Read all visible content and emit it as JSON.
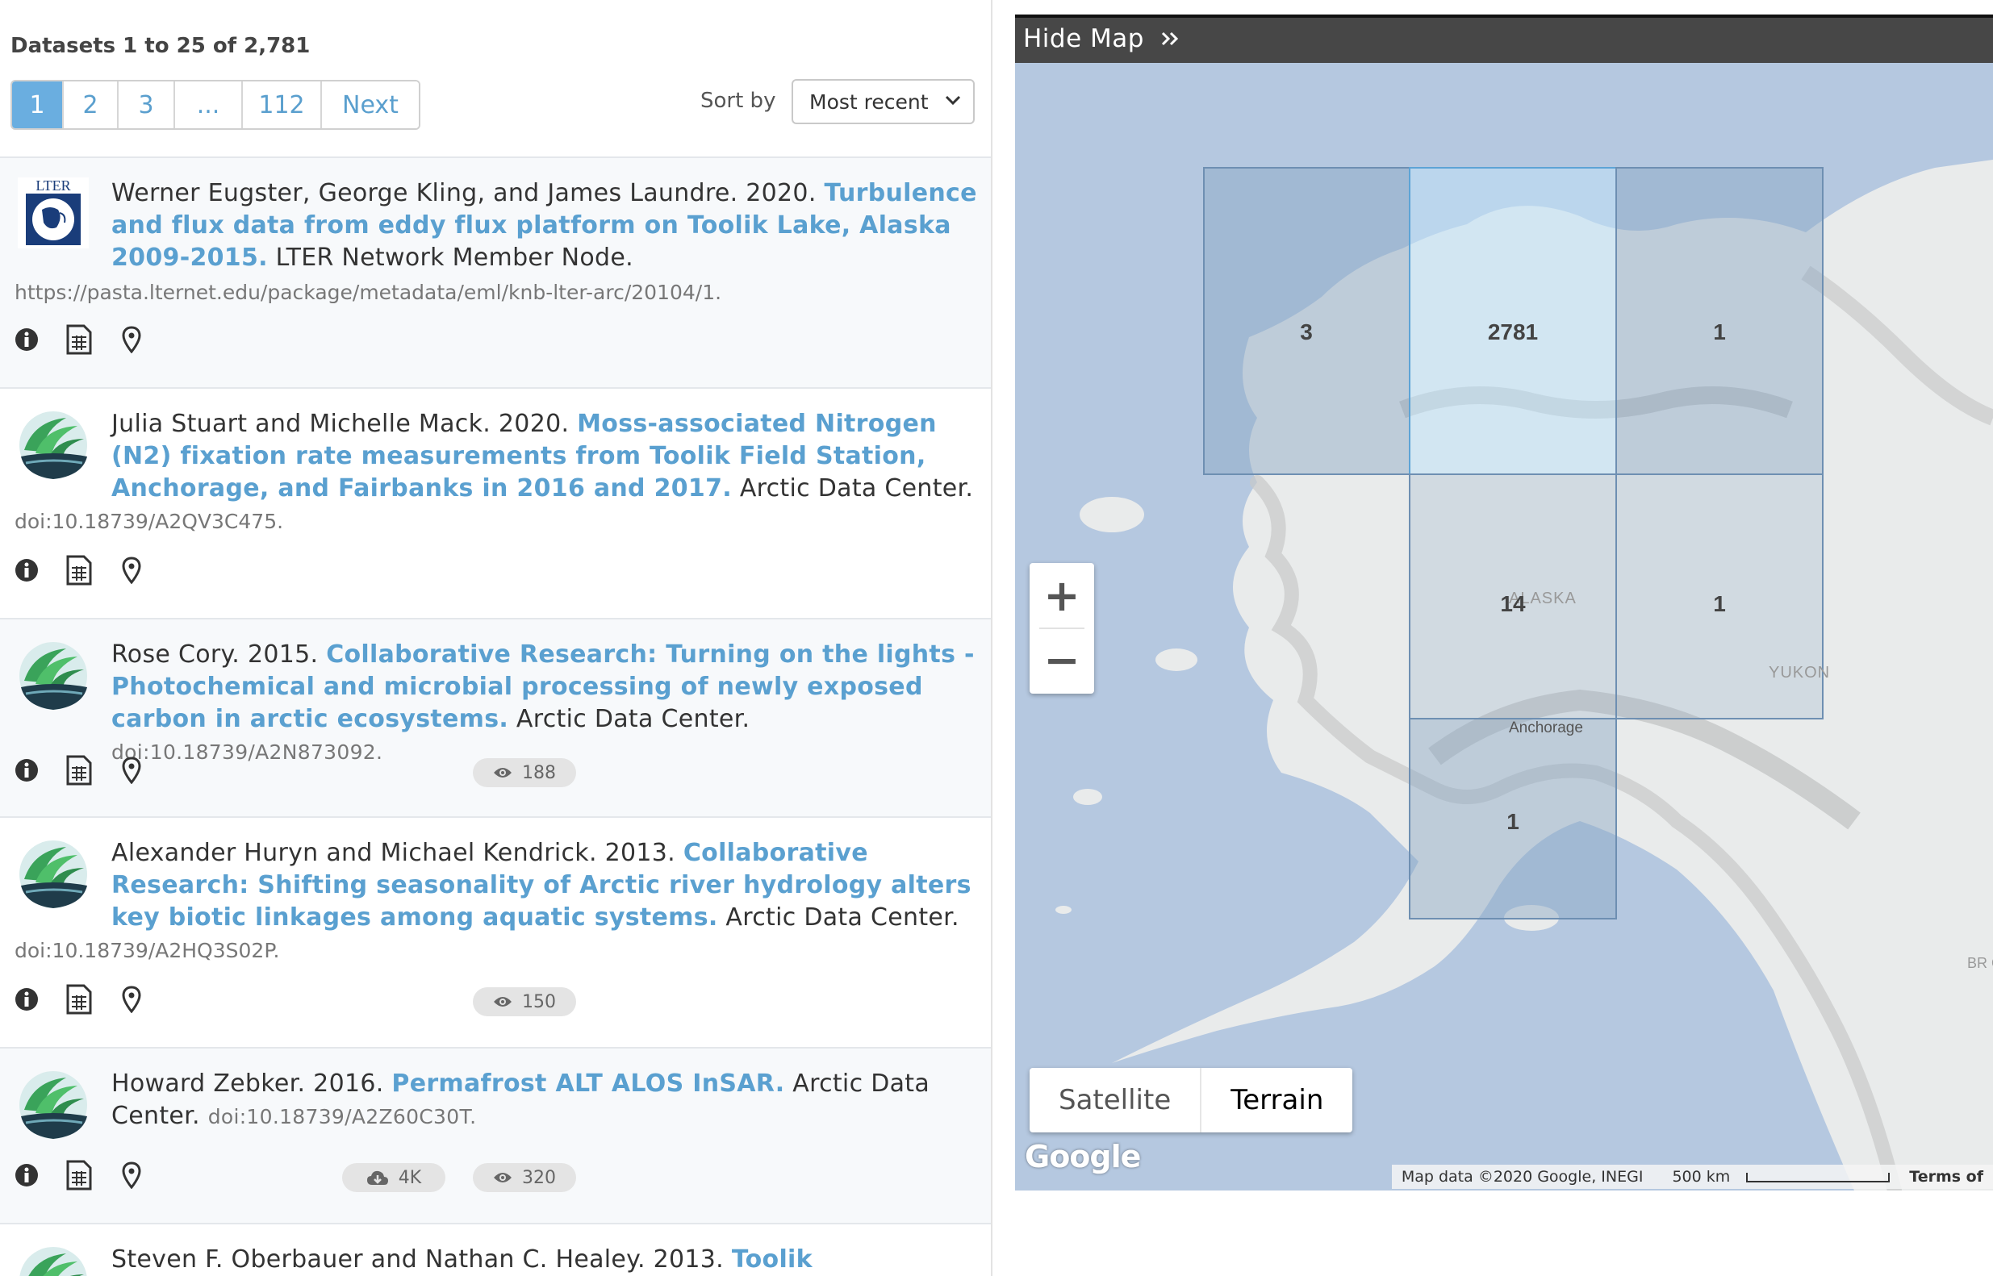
{
  "results_header": {
    "count_text": "Datasets 1 to 25 of 2,781",
    "pages": [
      "1",
      "2",
      "3",
      "...",
      "112",
      "Next"
    ],
    "active_page": "1",
    "sort_label": "Sort by",
    "sort_value": "Most recent"
  },
  "results": [
    {
      "authors": "Werner Eugster, George Kling, and James Laundre. 2020. ",
      "title": "Turbulence and flux data from eddy flux platform on Toolik Lake, Alaska 2009-2015.",
      "repository": " LTER Network Member Node.",
      "identifier": "https://pasta.lternet.edu/package/metadata/eml/knb-lter-arc/20104/1.",
      "logo": "lter-logo",
      "downloads": "",
      "views": ""
    },
    {
      "authors": "Julia Stuart and Michelle Mack. 2020. ",
      "title": "Moss-associated Nitrogen (N2) fixation rate measurements from Toolik Field Station, Anchorage, and Fairbanks in 2016 and 2017.",
      "repository": " Arctic Data Center.",
      "identifier": "doi:10.18739/A2QV3C475.",
      "logo": "arctic-data-center-logo",
      "downloads": "",
      "views": ""
    },
    {
      "authors": "Rose Cory. 2015. ",
      "title": "Collaborative Research: Turning on the lights - Photochemical and microbial processing of newly exposed carbon in arctic ecosystems.",
      "repository": " Arctic Data Center. ",
      "identifier": "doi:10.18739/A2N873092.",
      "logo": "arctic-data-center-logo",
      "downloads": "",
      "views": "188"
    },
    {
      "authors": "Alexander Huryn and Michael Kendrick. 2013. ",
      "title": "Collaborative Research: Shifting seasonality of Arctic river hydrology alters key biotic linkages among aquatic systems.",
      "repository": " Arctic Data Center.",
      "identifier": "doi:10.18739/A2HQ3S02P.",
      "logo": "arctic-data-center-logo",
      "downloads": "",
      "views": "150"
    },
    {
      "authors": "Howard Zebker. 2016. ",
      "title": "Permafrost ALT ALOS InSAR.",
      "repository": " Arctic Data Center. ",
      "identifier": "doi:10.18739/A2Z60C30T.",
      "logo": "arctic-data-center-logo",
      "downloads": "4K",
      "views": "320"
    },
    {
      "authors": "Steven F. Oberbauer and Nathan C. Healey. 2013. ",
      "title": "Toolik",
      "repository": "",
      "identifier": "",
      "logo": "arctic-data-center-logo",
      "downloads": "",
      "views": ""
    }
  ],
  "result_icons": [
    "info-icon",
    "metadata-table-icon",
    "map-marker-icon"
  ],
  "map": {
    "toggle_label": "Hide Map",
    "toggle_icon": "double-chevron-right-icon",
    "zoom_in": "+",
    "zoom_out": "−",
    "map_types": [
      "Satellite",
      "Terrain"
    ],
    "selected_map_type": "Terrain",
    "place_labels": [
      "ALASKA",
      "YUKON",
      "Anchorage",
      "BR COL"
    ],
    "cluster_counts": [
      "3",
      "2781",
      "1",
      "14",
      "1",
      "1"
    ],
    "google_logo": "Google",
    "attribution": "Map data ©2020 Google, INEGI",
    "scale_label": "500 km",
    "terms": "Terms of"
  },
  "colors": {
    "link_blue": "#5aa0d0",
    "active_page_bg": "#6aaee0",
    "map_header_bg": "#474747",
    "ocean": "#b5c8e0",
    "land": "#e9ebeb",
    "tile_fill": "#8aa6c4"
  }
}
